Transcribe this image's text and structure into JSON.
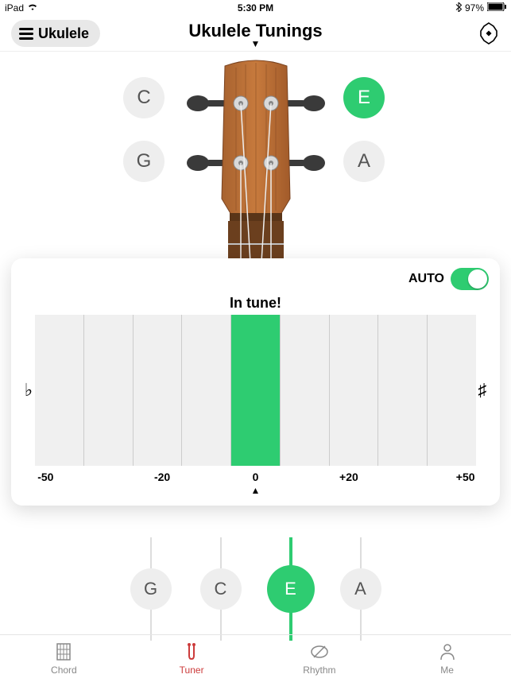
{
  "status": {
    "device": "iPad",
    "time": "5:30 PM",
    "battery": "97%"
  },
  "header": {
    "instrument": "Ukulele",
    "title": "Ukulele Tunings"
  },
  "headstock_notes": {
    "top_left": "C",
    "bottom_left": "G",
    "top_right": "E",
    "bottom_right": "A",
    "active": "E"
  },
  "tuner": {
    "auto_label": "AUTO",
    "auto_on": true,
    "status": "In tune!",
    "flat": "♭",
    "sharp": "♯",
    "center_value": "0",
    "scale": [
      "-50",
      "-20",
      "+20",
      "+50"
    ]
  },
  "strings": [
    {
      "label": "G",
      "active": false
    },
    {
      "label": "C",
      "active": false
    },
    {
      "label": "E",
      "active": true
    },
    {
      "label": "A",
      "active": false
    }
  ],
  "tabs": {
    "chord": "Chord",
    "tuner": "Tuner",
    "rhythm": "Rhythm",
    "me": "Me",
    "active": "tuner"
  },
  "colors": {
    "accent": "#2ecc71",
    "tab_active": "#cc3b3b"
  }
}
